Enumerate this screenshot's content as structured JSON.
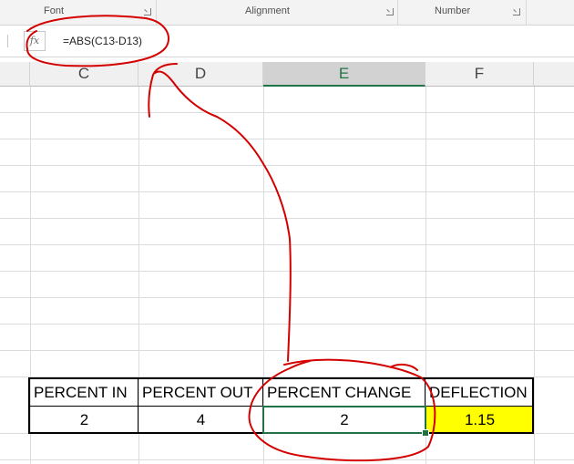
{
  "ribbon": {
    "groups": [
      {
        "label": "Font"
      },
      {
        "label": "Alignment"
      },
      {
        "label": "Number"
      }
    ]
  },
  "formula_bar": {
    "fx_label": "fx",
    "formula": "=ABS(C13-D13)"
  },
  "columns": [
    "C",
    "D",
    "E",
    "F"
  ],
  "selected_column": "E",
  "table": {
    "headers": [
      "PERCENT IN",
      "PERCENT OUT",
      "PERCENT CHANGE",
      "DEFLECTION"
    ],
    "values": [
      "2",
      "4",
      "2",
      "1.15"
    ]
  },
  "colors": {
    "accent": "#217346",
    "highlight": "#ffff00",
    "annotation": "#d40000"
  }
}
